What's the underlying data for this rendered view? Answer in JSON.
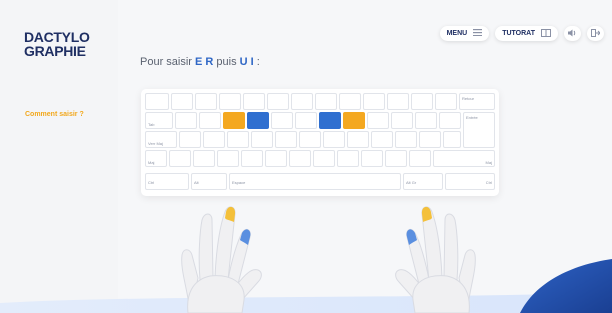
{
  "sidebar": {
    "logo_line1": "DACTYLO",
    "logo_line2": "GRAPHIE",
    "help_link": "Comment saisir ?"
  },
  "header": {
    "menu_label": "MENU",
    "tutorial_label": "TUTORAT"
  },
  "instruction": {
    "prefix": "Pour saisir ",
    "keys1": "E R",
    "middle": " puis ",
    "keys2": "U I",
    "suffix": " :"
  },
  "keyboard": {
    "retour": "Retour",
    "tab": "Tab",
    "entree": "Entrée",
    "verr_maj": "Verr Maj",
    "maj_left": "Maj",
    "maj_right": "Maj",
    "ctrl_left": "Ctrl",
    "alt": "Alt",
    "espace": "Espace",
    "alt_gr": "Alt Gr",
    "ctrl_right": "Ctrl",
    "highlight_left": "#f4a820",
    "highlight_right": "#2f6fd0"
  }
}
